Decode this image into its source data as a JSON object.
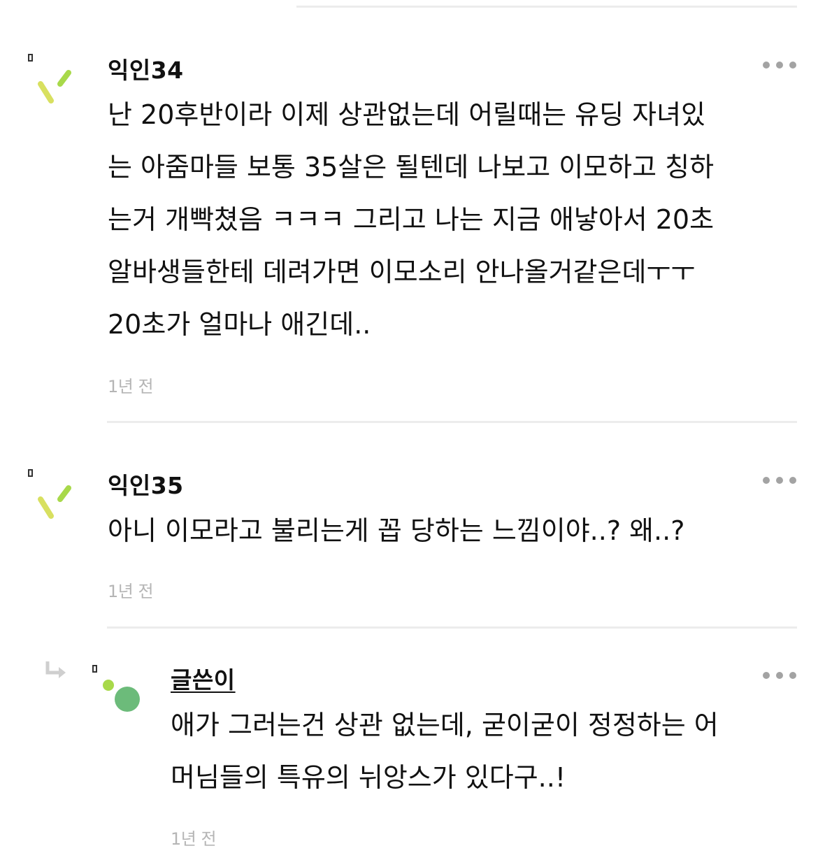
{
  "comments": [
    {
      "author": "익인34",
      "lines": [
        "난 20후반이라 이제 상관없는데 어릴때는 유딩 자녀있",
        "는 아줌마들 보통 35살은 될텐데 나보고 이모하고 칭하",
        "는거 개빡쳤음 ㅋㅋㅋ 그리고 나는 지금 애낳아서 20초",
        "알바생들한테 데려가면 이모소리 안나올거같은데ㅜㅜ",
        "20초가 얼마나 애긴데.."
      ],
      "time": "1년 전",
      "more_icon": "more-dots-icon"
    },
    {
      "author": "익인35",
      "lines": [
        "아니 이모라고 불리는게 꼽 당하는 느낌이야..? 왜..?"
      ],
      "time": "1년 전",
      "more_icon": "more-dots-icon"
    }
  ],
  "reply": {
    "author": "글쓴이",
    "lines": [
      "애가 그러는건 상관 없는데, 굳이굳이 정정하는 어",
      "머님들의 특유의 뉘앙스가 있다구..!"
    ],
    "time": "1년 전",
    "reply_icon": "reply-arrow-icon",
    "more_icon": "more-dots-icon"
  },
  "colors": {
    "avatar_green_dark": "#6cbb7a",
    "avatar_green_light": "#a8d94a",
    "avatar_yellow": "#d8e060",
    "time_gray": "#b5b5b5",
    "divider": "#ececec"
  }
}
